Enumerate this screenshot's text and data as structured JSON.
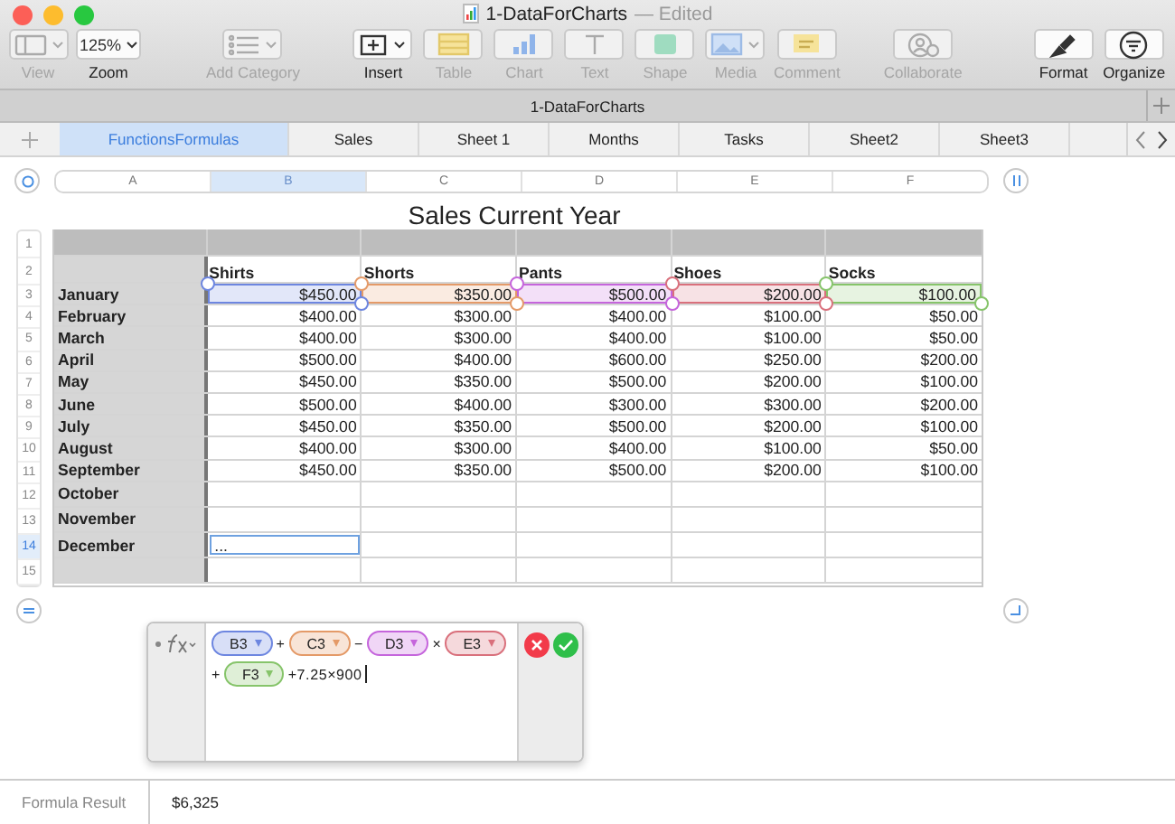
{
  "window": {
    "title": "1-DataForCharts",
    "status": "— Edited"
  },
  "toolbar": [
    {
      "kind": "view",
      "label": "View",
      "disabled": true
    },
    {
      "kind": "zoom",
      "label": "Zoom",
      "value": "125%",
      "disabled": false
    },
    {
      "kind": "category",
      "label": "Add Category",
      "disabled": true
    },
    {
      "kind": "insert",
      "label": "Insert",
      "disabled": false
    },
    {
      "kind": "table",
      "label": "Table",
      "disabled": true
    },
    {
      "kind": "chart",
      "label": "Chart",
      "disabled": true
    },
    {
      "kind": "text",
      "label": "Text",
      "disabled": true
    },
    {
      "kind": "shape",
      "label": "Shape",
      "disabled": true
    },
    {
      "kind": "media",
      "label": "Media",
      "disabled": true
    },
    {
      "kind": "comment",
      "label": "Comment",
      "disabled": true
    },
    {
      "kind": "collaborate",
      "label": "Collaborate",
      "disabled": true
    },
    {
      "kind": "format",
      "label": "Format",
      "disabled": false
    },
    {
      "kind": "organize",
      "label": "Organize",
      "disabled": false
    }
  ],
  "document_title": "1-DataForCharts",
  "sheet_tabs": [
    {
      "label": "FunctionsFormulas",
      "selected": true
    },
    {
      "label": "Sales",
      "selected": false
    },
    {
      "label": "Sheet 1",
      "selected": false
    },
    {
      "label": "Months",
      "selected": false
    },
    {
      "label": "Tasks",
      "selected": false
    },
    {
      "label": "Sheet2",
      "selected": false
    },
    {
      "label": "Sheet3",
      "selected": false
    }
  ],
  "column_headers": [
    {
      "label": "A",
      "selected": false
    },
    {
      "label": "B",
      "selected": true
    },
    {
      "label": "C",
      "selected": false
    },
    {
      "label": "D",
      "selected": false
    },
    {
      "label": "E",
      "selected": false
    },
    {
      "label": "F",
      "selected": false
    }
  ],
  "row_numbers": [
    {
      "label": "1",
      "selected": false
    },
    {
      "label": "2",
      "selected": false
    },
    {
      "label": "3",
      "selected": false
    },
    {
      "label": "4",
      "selected": false
    },
    {
      "label": "5",
      "selected": false
    },
    {
      "label": "6",
      "selected": false
    },
    {
      "label": "7",
      "selected": false
    },
    {
      "label": "8",
      "selected": false
    },
    {
      "label": "9",
      "selected": false
    },
    {
      "label": "10",
      "selected": false
    },
    {
      "label": "11",
      "selected": false
    },
    {
      "label": "12",
      "selected": false
    },
    {
      "label": "13",
      "selected": false
    },
    {
      "label": "14",
      "selected": true
    },
    {
      "label": "15",
      "selected": false
    }
  ],
  "table": {
    "title": "Sales Current Year",
    "columns": [
      {
        "name": "Shirts",
        "color": "#6d86e0"
      },
      {
        "name": "Shorts",
        "color": "#e49a68"
      },
      {
        "name": "Pants",
        "color": "#c565dc"
      },
      {
        "name": "Shoes",
        "color": "#d9707c"
      },
      {
        "name": "Socks",
        "color": "#86c46a"
      }
    ],
    "rows": [
      {
        "label": "January",
        "cells": [
          "$450.00",
          "$350.00",
          "$500.00",
          "$200.00",
          "$100.00"
        ],
        "referenced": true,
        "editing": false
      },
      {
        "label": "February",
        "cells": [
          "$400.00",
          "$300.00",
          "$400.00",
          "$100.00",
          "$50.00"
        ],
        "referenced": false,
        "editing": false
      },
      {
        "label": "March",
        "cells": [
          "$400.00",
          "$300.00",
          "$400.00",
          "$100.00",
          "$50.00"
        ],
        "referenced": false,
        "editing": false
      },
      {
        "label": "April",
        "cells": [
          "$500.00",
          "$400.00",
          "$600.00",
          "$250.00",
          "$200.00"
        ],
        "referenced": false,
        "editing": false
      },
      {
        "label": "May",
        "cells": [
          "$450.00",
          "$350.00",
          "$500.00",
          "$200.00",
          "$100.00"
        ],
        "referenced": false,
        "editing": false
      },
      {
        "label": "June",
        "cells": [
          "$500.00",
          "$400.00",
          "$300.00",
          "$300.00",
          "$200.00"
        ],
        "referenced": false,
        "editing": false
      },
      {
        "label": "July",
        "cells": [
          "$450.00",
          "$350.00",
          "$500.00",
          "$200.00",
          "$100.00"
        ],
        "referenced": false,
        "editing": false
      },
      {
        "label": "August",
        "cells": [
          "$400.00",
          "$300.00",
          "$400.00",
          "$100.00",
          "$50.00"
        ],
        "referenced": false,
        "editing": false
      },
      {
        "label": "September",
        "cells": [
          "$450.00",
          "$350.00",
          "$500.00",
          "$200.00",
          "$100.00"
        ],
        "referenced": false,
        "editing": false
      },
      {
        "label": "October",
        "referenced": false,
        "editing": false
      },
      {
        "label": "November",
        "referenced": false,
        "editing": false
      },
      {
        "label": "December",
        "cells": [
          "..."
        ],
        "referenced": false,
        "editing": true
      },
      {
        "referenced": false,
        "editing": false
      }
    ]
  },
  "formula_editor": {
    "tokens": [
      {
        "kind": "ref",
        "text": "B3",
        "color": "#6d86e0"
      },
      {
        "kind": "op",
        "text": "+"
      },
      {
        "kind": "ref",
        "text": "C3",
        "color": "#e49a68"
      },
      {
        "kind": "op",
        "text": "−"
      },
      {
        "kind": "ref",
        "text": "D3",
        "color": "#c565dc"
      },
      {
        "kind": "op",
        "text": "×"
      },
      {
        "kind": "ref",
        "text": "E3",
        "color": "#d9707c"
      },
      {
        "kind": "op",
        "text": "+"
      },
      {
        "kind": "ref",
        "text": "F3",
        "color": "#86c46a"
      },
      {
        "kind": "op",
        "text": "+7.25×900"
      }
    ]
  },
  "status_bar": {
    "label": "Formula Result",
    "value": "$6,325"
  }
}
